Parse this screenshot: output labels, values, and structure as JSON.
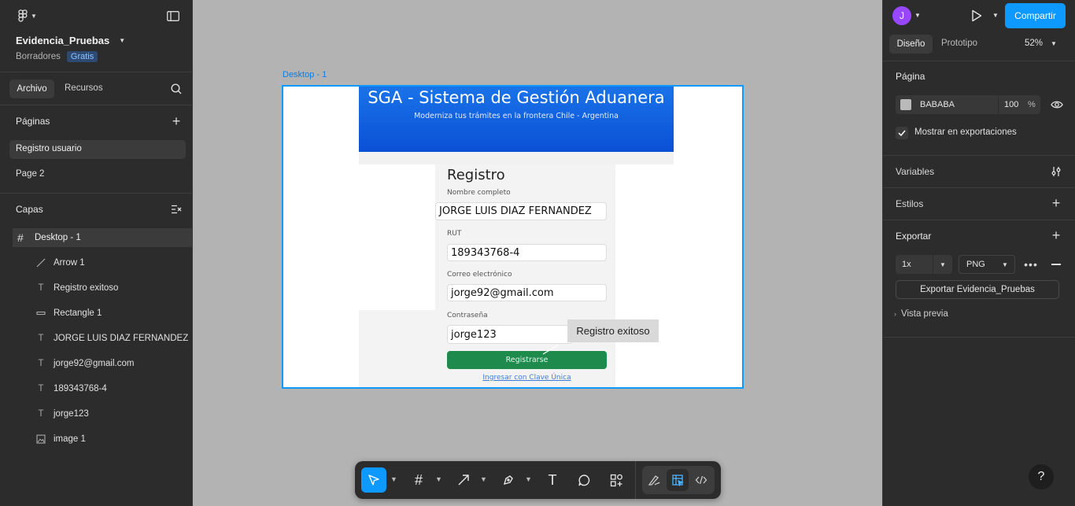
{
  "file": {
    "name": "Evidencia_Pruebas",
    "location": "Borradores",
    "plan": "Gratis"
  },
  "left_tabs": {
    "archivo": "Archivo",
    "recursos": "Recursos"
  },
  "pages": {
    "title": "Páginas",
    "items": [
      "Registro usuario",
      "Page 2"
    ]
  },
  "layers": {
    "title": "Capas",
    "frame": "Desktop - 1",
    "items": [
      "Arrow 1",
      "Registro exitoso",
      "Rectangle 1",
      "JORGE LUIS DIAZ FERNANDEZ",
      "jorge92@gmail.com",
      "189343768-4",
      "jorge123",
      "image 1"
    ]
  },
  "canvas": {
    "frame_label": "Desktop - 1",
    "banner_title": "SGA - Sistema de Gestión Aduanera",
    "banner_subtitle": "Moderniza tus trámites en la frontera Chile - Argentina",
    "form_title": "Registro",
    "label_name": "Nombre completo",
    "value_name": "JORGE LUIS  DIAZ FERNANDEZ",
    "label_rut": "RUT",
    "value_rut": "189343768-4",
    "label_email": "Correo electrónico",
    "value_email": "jorge92@gmail.com",
    "label_password": "Contraseña",
    "value_password": "jorge123",
    "submit_label": "Registrarse",
    "clave_link": "Ingresar con Clave Única",
    "toast": "Registro exitoso"
  },
  "right": {
    "avatar_letter": "J",
    "share": "Compartir",
    "tab_design": "Diseño",
    "tab_prototype": "Prototipo",
    "zoom": "52%",
    "page_section": "Página",
    "page_color": "BABABA",
    "page_opacity": "100",
    "percent": "%",
    "show_exports": "Mostrar en exportaciones",
    "variables": "Variables",
    "styles": "Estilos",
    "export": "Exportar",
    "export_scale": "1x",
    "export_format": "PNG",
    "export_button": "Exportar Evidencia_Pruebas",
    "preview": "Vista previa",
    "help": "?"
  },
  "colors": {
    "accent": "#0d99ff",
    "panel": "#2c2c2c",
    "canvas": "#b3b3b3",
    "avatar": "#9747ff",
    "banner": "#1a73e8",
    "submit": "#1e8a4c"
  }
}
